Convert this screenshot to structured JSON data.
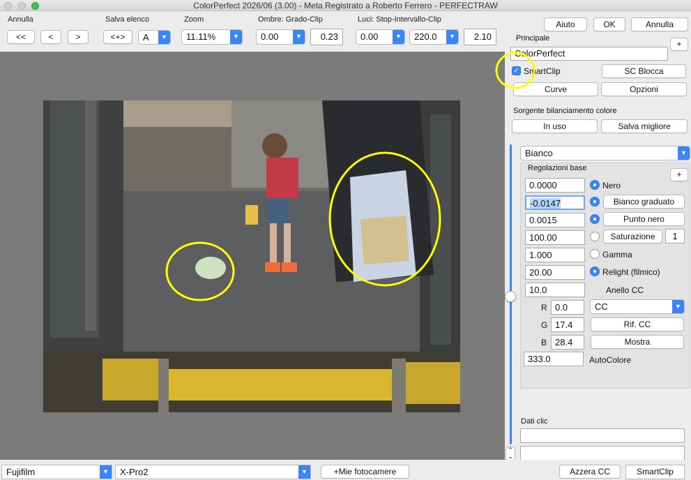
{
  "window": {
    "title": "ColorPerfect 2026/06 (3.00) -  Meta Registrato a Roberto Ferrero - PERFECTRAW"
  },
  "toolbar": {
    "annulla_label": "Annulla",
    "nav_first": "<<",
    "nav_prev": "<",
    "nav_next": ">",
    "salva_elenco_label": "Salva elenco",
    "salva_button": "<+>",
    "salva_select": "A",
    "zoom_label": "Zoom",
    "zoom_value": "11.11%",
    "ombre_label": "Ombre: Grado-Clip",
    "ombre_grado": "0.00",
    "ombre_clip": "0.23",
    "luci_label": "Luci: Stop-Intervallo-Clip",
    "luci_stop": "0.00",
    "luci_intervallo": "220.0",
    "luci_clip": "2.10",
    "aiuto": "Aiuto",
    "ok": "OK",
    "annulla_button": "Annulla"
  },
  "sidebar": {
    "principale_label": "Principale",
    "plus": "+",
    "principale_value": "ColorPerfect",
    "smartclip_label": "SmartClip",
    "smartclip_checked": true,
    "sc_blocca": "SC Blocca",
    "curve": "Curve",
    "opzioni": "Opzioni",
    "sorgente_label": "Sorgente bilanciamento colore",
    "in_uso": "In uso",
    "salva_migliore": "Salva migliore",
    "bianco_select": "Bianco",
    "regolazioni_label": "Regolazioni base",
    "regolazioni_plus": "+",
    "rows": [
      {
        "value": "0.0000",
        "label": "Nero",
        "radio": true,
        "kind": "text"
      },
      {
        "value": "-0.0147",
        "label": "Bianco graduato",
        "radio": true,
        "kind": "button",
        "selected": true
      },
      {
        "value": "0.0015",
        "label": "Punto nero",
        "radio": true,
        "kind": "button"
      },
      {
        "value": "100.00",
        "label": "Saturazione",
        "radio": false,
        "kind": "button",
        "extra": "1"
      },
      {
        "value": "1.000",
        "label": "Gamma",
        "radio": false,
        "kind": "text"
      },
      {
        "value": "20.00",
        "label": "Relight (filmico)",
        "radio": true,
        "kind": "text"
      },
      {
        "value": "10.0",
        "label": "Anello CC",
        "kind": "text-bold"
      }
    ],
    "r_label": "R",
    "r_value": "0.0",
    "g_label": "G",
    "g_value": "17.4",
    "b_label": "B",
    "b_value": "28.4",
    "cc_select": "CC",
    "rif_cc": "Rif. CC",
    "mostra": "Mostra",
    "autocolore_value": "333.0",
    "autocolore_label": "AutoColore",
    "dati_clic_label": "Dati clic",
    "dati_clic_1": "",
    "dati_clic_2": ""
  },
  "bottom": {
    "camera_make": "Fujifilm",
    "camera_model": "X-Pro2",
    "mie_fotocamere": "+Mie fotocamere",
    "azzera_cc": "Azzera CC",
    "smartclip": "SmartClip"
  },
  "colors": {
    "accent": "#3b86f7",
    "annotation": "#ffff00",
    "canvas_bg": "#7b7b7b"
  }
}
